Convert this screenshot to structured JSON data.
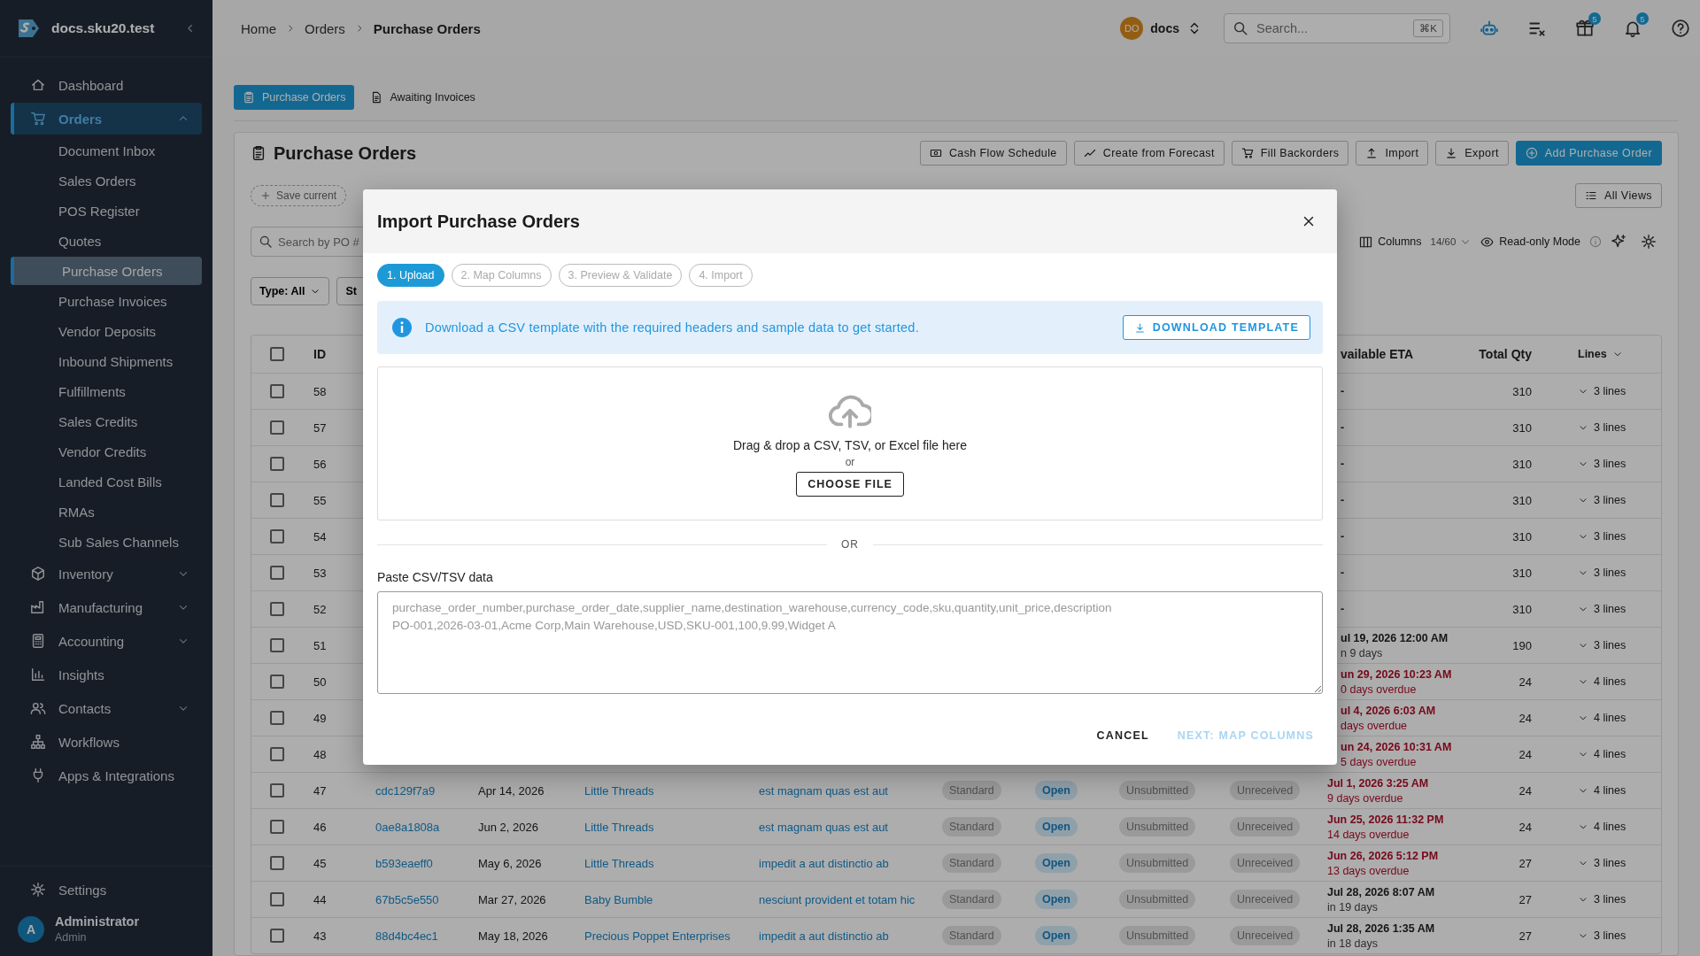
{
  "sidebar": {
    "brand": "docs.sku20.test",
    "items": [
      {
        "kind": "home",
        "label": "Dashboard",
        "selected": false
      },
      {
        "kind": "cart",
        "label": "Orders",
        "selected": true,
        "expanded": true,
        "children": [
          {
            "label": "Document Inbox",
            "selected": false
          },
          {
            "label": "Sales Orders",
            "selected": false
          },
          {
            "label": "POS Register",
            "selected": false
          },
          {
            "label": "Quotes",
            "selected": false
          },
          {
            "label": "Purchase Orders",
            "selected": true
          },
          {
            "label": "Purchase Invoices",
            "selected": false
          },
          {
            "label": "Vendor Deposits",
            "selected": false
          },
          {
            "label": "Inbound Shipments",
            "selected": false
          },
          {
            "label": "Fulfillments",
            "selected": false
          },
          {
            "label": "Sales Credits",
            "selected": false
          },
          {
            "label": "Vendor Credits",
            "selected": false
          },
          {
            "label": "Landed Cost Bills",
            "selected": false
          },
          {
            "label": "RMAs",
            "selected": false
          },
          {
            "label": "Sub Sales Channels",
            "selected": false
          }
        ]
      },
      {
        "kind": "box",
        "label": "Inventory",
        "selected": false,
        "expanded": false
      },
      {
        "kind": "factory",
        "label": "Manufacturing",
        "selected": false,
        "expanded": false
      },
      {
        "kind": "calculator",
        "label": "Accounting",
        "selected": false,
        "expanded": false
      },
      {
        "kind": "chart",
        "label": "Insights",
        "selected": false
      },
      {
        "kind": "people",
        "label": "Contacts",
        "selected": false,
        "expanded": false
      },
      {
        "kind": "tree",
        "label": "Workflows",
        "selected": false
      },
      {
        "kind": "plug",
        "label": "Apps & Integrations",
        "selected": false
      }
    ],
    "settings": "Settings",
    "user": {
      "initial": "A",
      "name": "Administrator",
      "role": "Admin"
    }
  },
  "topbar": {
    "breadcrumb": [
      "Home",
      "Orders",
      "Purchase Orders"
    ],
    "workspace": {
      "initials": "DO",
      "name": "docs"
    },
    "search": {
      "placeholder": "Search...",
      "shortcut": "⌘K"
    },
    "icons": [
      {
        "kind": "robot"
      },
      {
        "kind": "checklist"
      },
      {
        "kind": "gift",
        "badge": "5"
      },
      {
        "kind": "bell",
        "badge": "5"
      },
      {
        "kind": "help"
      }
    ]
  },
  "tabs": [
    {
      "kind": "clipboard",
      "label": "Purchase Orders",
      "selected": true
    },
    {
      "kind": "doc",
      "label": "Awaiting Invoices",
      "selected": false
    }
  ],
  "page": {
    "title": "Purchase Orders",
    "actions": [
      {
        "kind": "cash",
        "label": "Cash Flow Schedule",
        "primary": false
      },
      {
        "kind": "trend",
        "label": "Create from Forecast",
        "primary": false
      },
      {
        "kind": "cart",
        "label": "Fill Backorders",
        "primary": false
      },
      {
        "kind": "upload",
        "label": "Import",
        "primary": false
      },
      {
        "kind": "download",
        "label": "Export",
        "primary": false
      },
      {
        "kind": "plus",
        "label": "Add Purchase Order",
        "primary": true
      }
    ],
    "save_view": "Save current",
    "views_button": "All Views",
    "search": {
      "placeholder": "Search by PO #"
    },
    "columns": {
      "label": "Columns",
      "count": "14/60"
    },
    "read_only": "Read-only Mode",
    "filters": [
      {
        "label": "Type: All",
        "dropdown": true
      },
      {
        "label": "St"
      }
    ]
  },
  "table": {
    "header": {
      "checked": false,
      "id": "ID",
      "eta": "vailable ETA",
      "qty": "Total Qty",
      "lines": "Lines"
    },
    "rows": [
      {
        "id": "58",
        "checked": false,
        "eta": "-",
        "overdue": false,
        "qty": "310",
        "lines": "3 lines"
      },
      {
        "id": "57",
        "checked": false,
        "eta": "-",
        "overdue": false,
        "qty": "310",
        "lines": "3 lines"
      },
      {
        "id": "56",
        "checked": false,
        "eta": "-",
        "overdue": false,
        "qty": "310",
        "lines": "3 lines"
      },
      {
        "id": "55",
        "checked": false,
        "eta": "-",
        "overdue": false,
        "qty": "310",
        "lines": "3 lines"
      },
      {
        "id": "54",
        "checked": false,
        "eta": "-",
        "overdue": false,
        "qty": "310",
        "lines": "3 lines"
      },
      {
        "id": "53",
        "checked": false,
        "eta": "-",
        "overdue": false,
        "qty": "310",
        "lines": "3 lines"
      },
      {
        "id": "52",
        "checked": false,
        "eta": "-",
        "overdue": false,
        "qty": "310",
        "lines": "3 lines"
      },
      {
        "id": "51",
        "checked": false,
        "eta": "ul 19, 2026 12:00 AM",
        "eta_note": "n 9 days",
        "overdue": false,
        "qty": "190",
        "lines": "3 lines"
      },
      {
        "id": "50",
        "checked": false,
        "eta": "un 29, 2026 10:23 AM",
        "eta_note": "0 days overdue",
        "overdue": true,
        "qty": "24",
        "lines": "4 lines"
      },
      {
        "id": "49",
        "checked": false,
        "eta": "ul 4, 2026 6:03 AM",
        "eta_note": "days overdue",
        "overdue": true,
        "qty": "24",
        "lines": "4 lines"
      },
      {
        "id": "48",
        "checked": false,
        "eta": "un 24, 2026 10:31 AM",
        "eta_note": "5 days overdue",
        "overdue": true,
        "qty": "24",
        "lines": "4 lines"
      },
      {
        "id": "47",
        "checked": false,
        "ref": "cdc129f7a9",
        "date": "Apr 14, 2026",
        "supplier": "Little Threads",
        "memo": "est magnam quas est aut",
        "type": "Standard",
        "status": "Open",
        "submission": "Unsubmitted",
        "receipt": "Unreceived",
        "eta": "Jul 1, 2026 3:25 AM",
        "eta_note": "9 days overdue",
        "overdue": true,
        "qty": "24",
        "lines": "4 lines"
      },
      {
        "id": "46",
        "checked": false,
        "ref": "0ae8a1808a",
        "date": "Jun 2, 2026",
        "supplier": "Little Threads",
        "memo": "est magnam quas est aut",
        "type": "Standard",
        "status": "Open",
        "submission": "Unsubmitted",
        "receipt": "Unreceived",
        "eta": "Jun 25, 2026 11:32 PM",
        "eta_note": "14 days overdue",
        "overdue": true,
        "qty": "24",
        "lines": "4 lines"
      },
      {
        "id": "45",
        "checked": false,
        "ref": "b593eaeff0",
        "date": "May 6, 2026",
        "supplier": "Little Threads",
        "memo": "impedit a aut distinctio ab",
        "type": "Standard",
        "status": "Open",
        "submission": "Unsubmitted",
        "receipt": "Unreceived",
        "eta": "Jun 26, 2026 5:12 PM",
        "eta_note": "13 days overdue",
        "overdue": true,
        "qty": "27",
        "lines": "3 lines"
      },
      {
        "id": "44",
        "checked": false,
        "ref": "67b5c5e550",
        "date": "Mar 27, 2026",
        "supplier": "Baby Bumble",
        "memo": "nesciunt provident et totam hic",
        "type": "Standard",
        "status": "Open",
        "submission": "Unsubmitted",
        "receipt": "Unreceived",
        "eta": "Jul 28, 2026 8:07 AM",
        "eta_note": "in 19 days",
        "overdue": false,
        "qty": "27",
        "lines": "3 lines"
      },
      {
        "id": "43",
        "checked": false,
        "ref": "88d4bc4ec1",
        "date": "May 18, 2026",
        "supplier": "Precious Poppet Enterprises",
        "memo": "impedit a aut distinctio ab",
        "type": "Standard",
        "status": "Open",
        "submission": "Unsubmitted",
        "receipt": "Unreceived",
        "eta": "Jul 28, 2026 1:35 AM",
        "eta_note": "in 18 days",
        "overdue": false,
        "qty": "27",
        "lines": "3 lines"
      }
    ]
  },
  "modal": {
    "title": "Import Purchase Orders",
    "steps": [
      {
        "label": "1. Upload",
        "selected": true
      },
      {
        "label": "2. Map Columns",
        "selected": false
      },
      {
        "label": "3. Preview & Validate",
        "selected": false
      },
      {
        "label": "4. Import",
        "selected": false
      }
    ],
    "banner": {
      "text": "Download a CSV template with the required headers and sample data to get started.",
      "button": "DOWNLOAD TEMPLATE"
    },
    "dropzone": {
      "text": "Drag & drop a CSV, TSV, or Excel file here",
      "or": "or",
      "button": "CHOOSE FILE"
    },
    "divider": "OR",
    "paste": {
      "label": "Paste CSV/TSV data",
      "placeholder": "purchase_order_number,purchase_order_date,supplier_name,destination_warehouse,currency_code,sku,quantity,unit_price,description\nPO-001,2026-03-01,Acme Corp,Main Warehouse,USD,SKU-001,100,9.99,Widget A"
    },
    "cancel": "CANCEL",
    "next": {
      "label": "NEXT: MAP COLUMNS",
      "disabled": true
    }
  }
}
